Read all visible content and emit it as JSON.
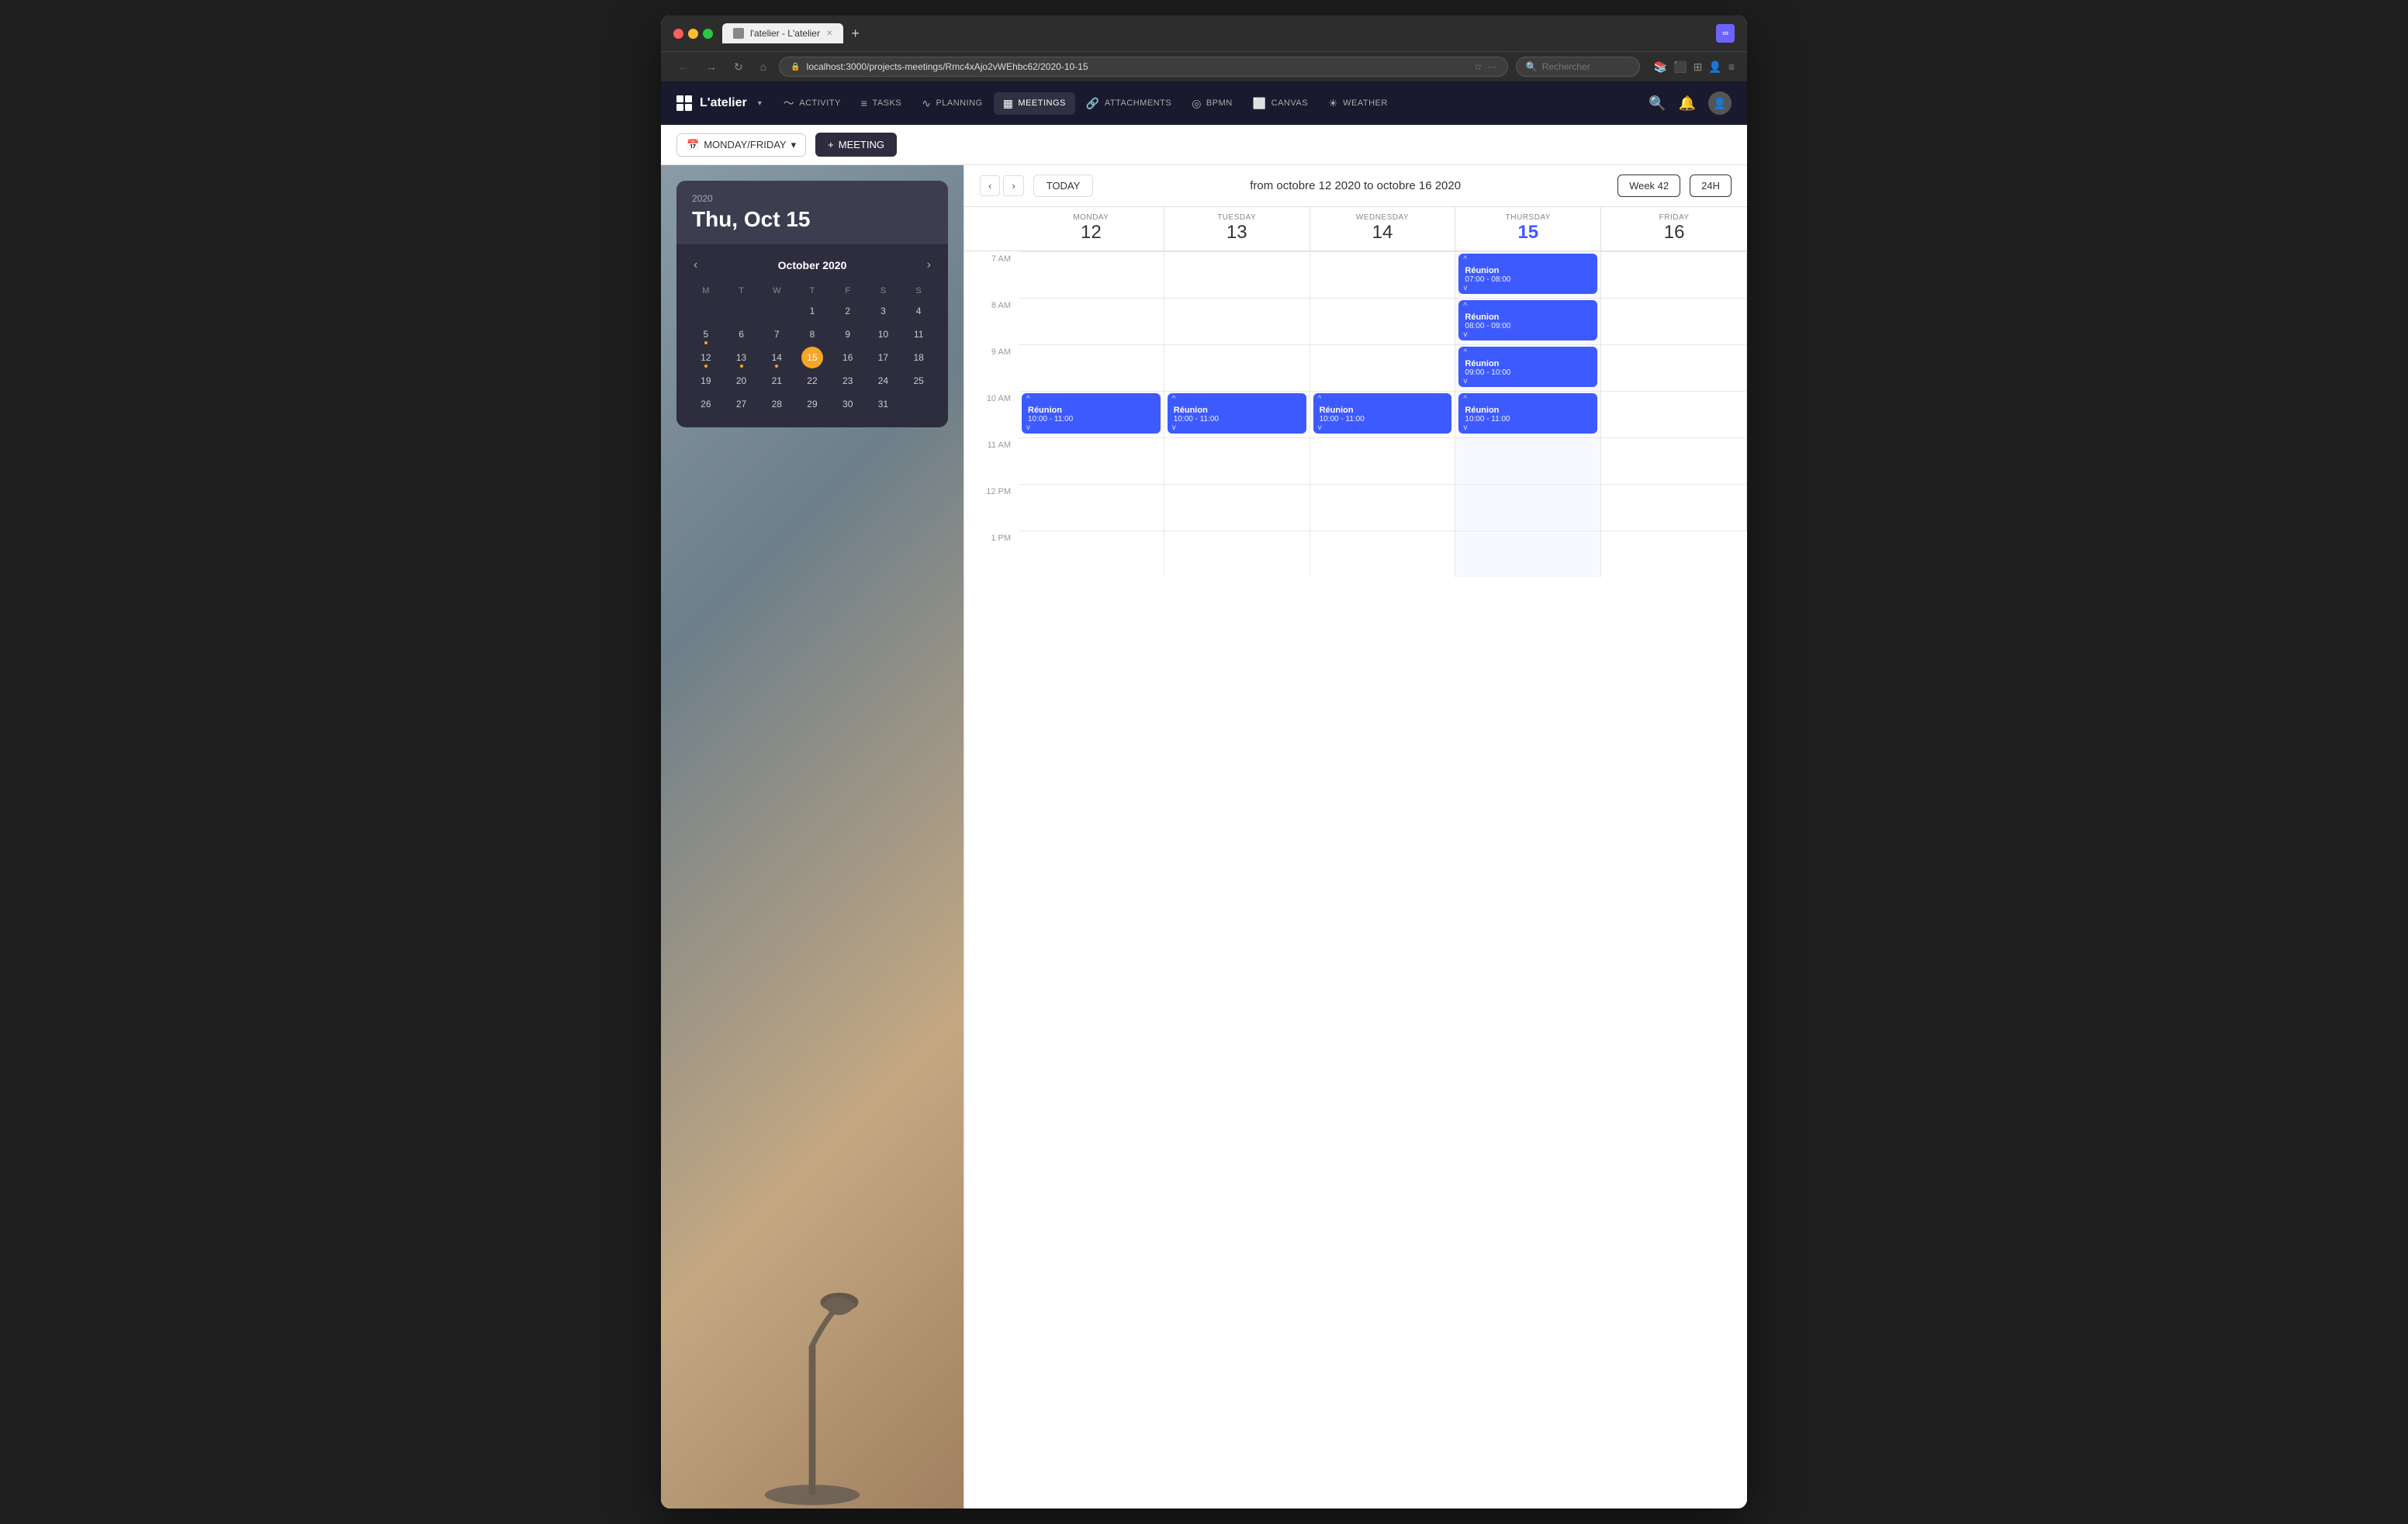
{
  "browser": {
    "tab_title": "l'atelier - L'atelier",
    "url": "localhost:3000/projects-meetings/Rmc4xAjo2vWEhbc62/2020-10-15",
    "search_placeholder": "Rechercher",
    "new_tab_label": "+",
    "ext_label": "∞"
  },
  "app": {
    "logo_label": "L'atelier",
    "dropdown_label": "▾",
    "nav_items": [
      {
        "id": "activity",
        "label": "ACTIVITY",
        "icon": "〜"
      },
      {
        "id": "tasks",
        "label": "TASKS",
        "icon": "≡"
      },
      {
        "id": "planning",
        "label": "PLANNING",
        "icon": "∿"
      },
      {
        "id": "meetings",
        "label": "MEETINGS",
        "icon": "📅",
        "active": true
      },
      {
        "id": "attachments",
        "label": "ATTACHMENTS",
        "icon": "🔗"
      },
      {
        "id": "bpmn",
        "label": "BPMN",
        "icon": "◎"
      },
      {
        "id": "canvas",
        "label": "CANVAS",
        "icon": "⬜"
      },
      {
        "id": "weather",
        "label": "WEATHER",
        "icon": "☀"
      }
    ]
  },
  "subheader": {
    "view_label": "MONDAY/FRIDAY",
    "add_meeting_label": "+ MEETING"
  },
  "mini_calendar": {
    "year": "2020",
    "date": "Thu, Oct 15",
    "month": "October 2020",
    "day_headers": [
      "M",
      "T",
      "W",
      "T",
      "F",
      "S",
      "S"
    ],
    "weeks": [
      [
        null,
        null,
        null,
        "1",
        "2",
        "3",
        "4"
      ],
      [
        "5",
        "6",
        "7",
        "8",
        "9",
        "10",
        "11"
      ],
      [
        "12",
        "13",
        "14",
        "15",
        "16",
        "17",
        "18"
      ],
      [
        "19",
        "20",
        "21",
        "22",
        "23",
        "24",
        "25"
      ],
      [
        "26",
        "27",
        "28",
        "29",
        "30",
        "31",
        null
      ]
    ],
    "dots": [
      "5",
      "12",
      "13",
      "14"
    ],
    "today": "15"
  },
  "calendar": {
    "prev_label": "‹",
    "next_label": "›",
    "today_label": "TODAY",
    "date_range": "from octobre 12 2020 to octobre 16 2020",
    "week_badge": "Week 42",
    "format_badge": "24H",
    "columns": [
      {
        "id": "mon",
        "day_name": "MONDAY",
        "day_num": "12",
        "today": false
      },
      {
        "id": "tue",
        "day_name": "TUESDAY",
        "day_num": "13",
        "today": false
      },
      {
        "id": "wed",
        "day_name": "WEDNESDAY",
        "day_num": "14",
        "today": false
      },
      {
        "id": "thu",
        "day_name": "THURSDAY",
        "day_num": "15",
        "today": true
      },
      {
        "id": "fri",
        "day_name": "FRIDAY",
        "day_num": "16",
        "today": false
      }
    ],
    "time_slots": [
      "8 AM",
      "9 AM",
      "10 AM",
      "11 AM",
      "12 PM",
      "1 PM"
    ],
    "events": [
      {
        "id": "e1",
        "title": "Réunion",
        "time": "07:00 - 08:00",
        "col": 3,
        "row_start": 0,
        "row_offset": 0,
        "height": 1
      },
      {
        "id": "e2",
        "title": "Réunion",
        "time": "08:00 - 09:00",
        "col": 3,
        "row_start": 1,
        "row_offset": 0,
        "height": 1
      },
      {
        "id": "e3",
        "title": "Réunion",
        "time": "09:00 - 10:00",
        "col": 3,
        "row_start": 2,
        "row_offset": 0,
        "height": 1
      },
      {
        "id": "e4",
        "title": "Réunion",
        "time": "10:00 - 11:00",
        "col": 0,
        "row_start": 3,
        "row_offset": 0,
        "height": 1
      },
      {
        "id": "e5",
        "title": "Réunion",
        "time": "10:00 - 11:00",
        "col": 1,
        "row_start": 3,
        "row_offset": 0,
        "height": 1
      },
      {
        "id": "e6",
        "title": "Réunion",
        "time": "10:00 - 11:00",
        "col": 2,
        "row_start": 3,
        "row_offset": 0,
        "height": 1
      },
      {
        "id": "e7",
        "title": "Réunion",
        "time": "10:00 - 11:00",
        "col": 3,
        "row_start": 3,
        "row_offset": 0,
        "height": 1
      }
    ]
  }
}
